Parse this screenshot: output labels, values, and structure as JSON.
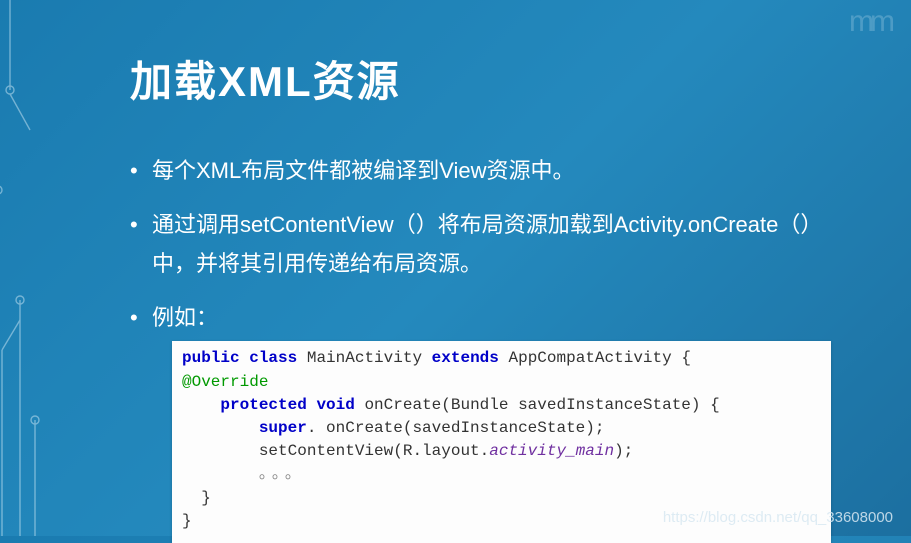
{
  "title": "加载XML资源",
  "bullets": {
    "b1": "每个XML布局文件都被编译到View资源中。",
    "b2": "通过调用setContentView（）将布局资源加载到Activity.onCreate（）中，并将其引用传递给布局资源。",
    "b3": "例如："
  },
  "code": {
    "l1_kw1": "public",
    "l1_kw2": "class",
    "l1_name": "MainActivity",
    "l1_kw3": "extends",
    "l1_ext": "AppCompatActivity {",
    "l2_anno": "@Override",
    "l3_kw1": "protected",
    "l3_kw2": "void",
    "l3_sig": "onCreate(Bundle savedInstanceState) {",
    "l4_kw1": "super",
    "l4_rest": ". onCreate(savedInstanceState);",
    "l5_pre": "setContentView(R.layout.",
    "l5_ital": "activity_main",
    "l5_post": ");",
    "l6_dots": "。。。",
    "l7_brace": "  }",
    "l8_brace": "}"
  },
  "watermark": "https://blog.csdn.net/qq_33608000",
  "deco_top_right": "mm"
}
